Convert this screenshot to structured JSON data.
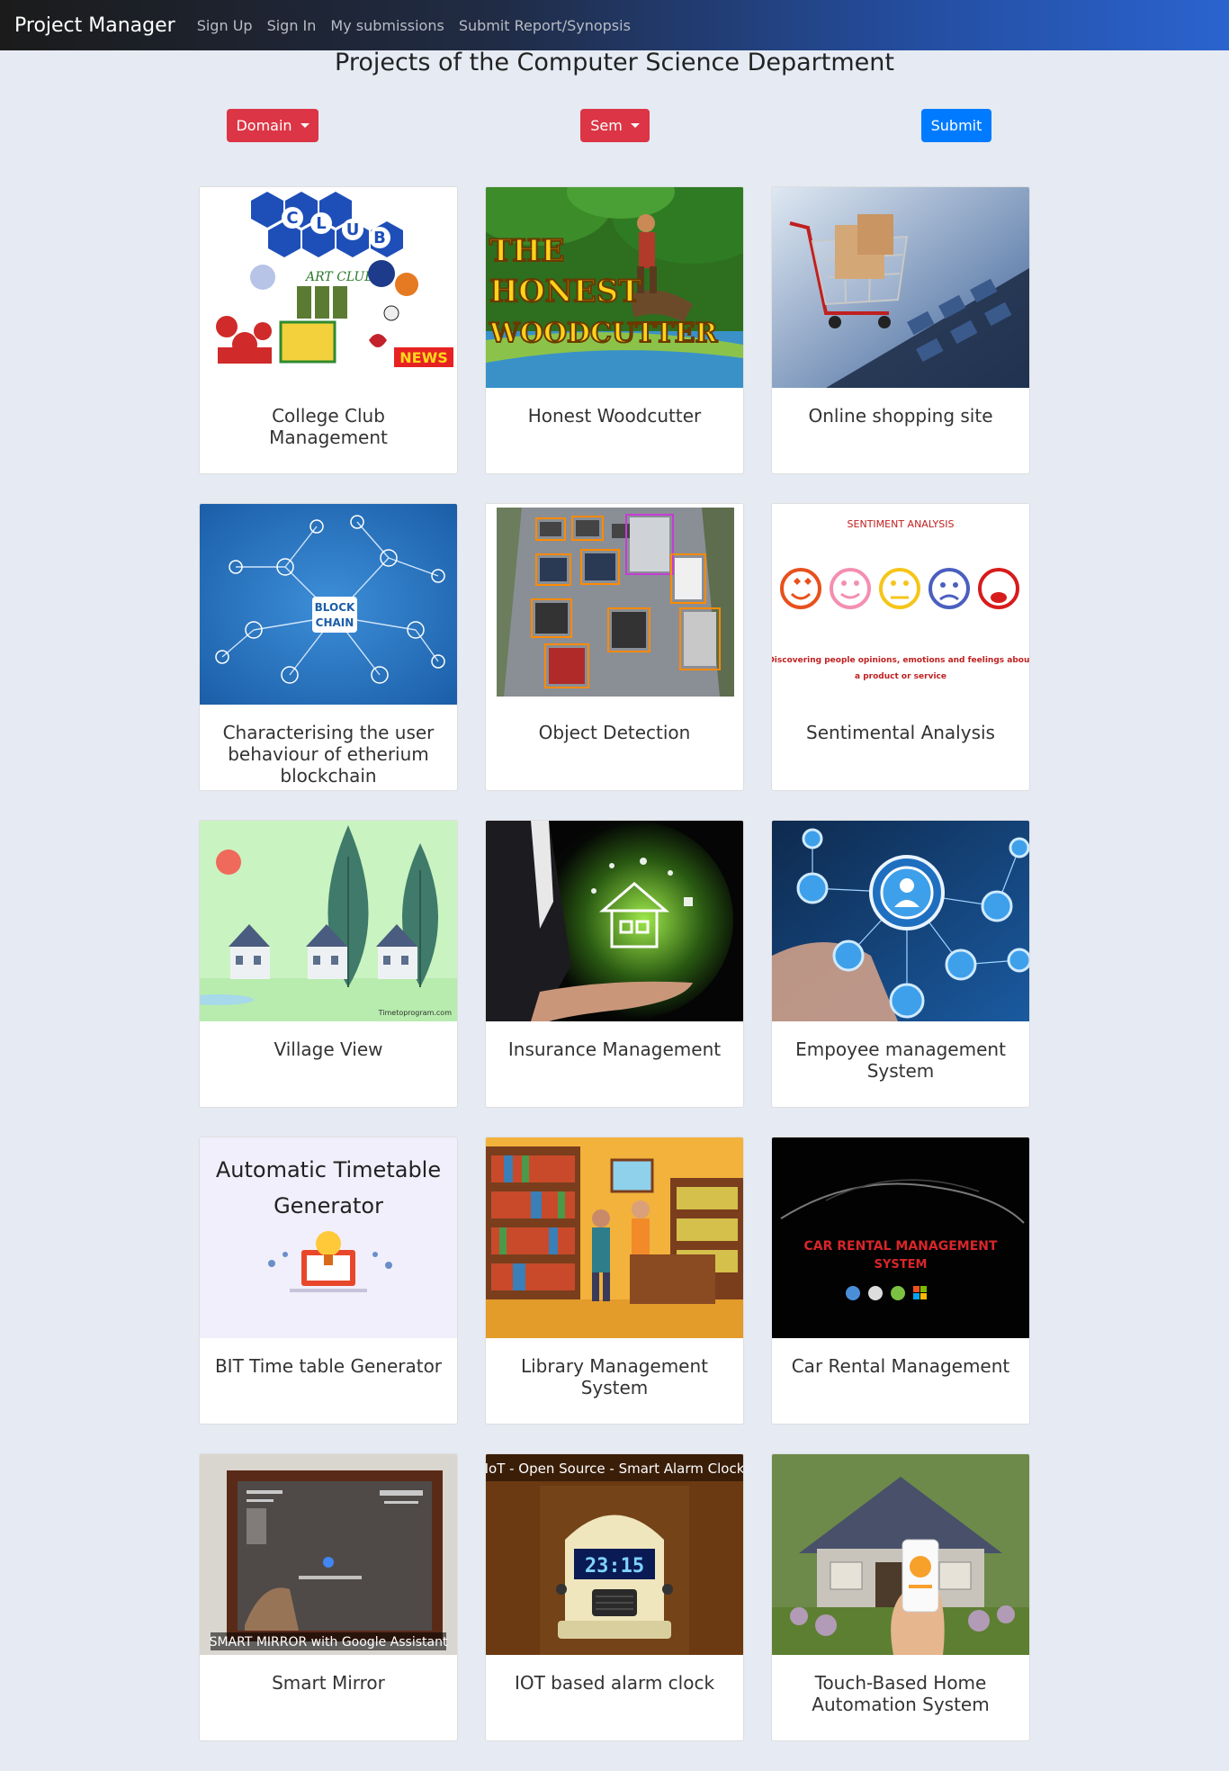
{
  "navbar": {
    "brand": "Project Manager",
    "links": [
      "Sign Up",
      "Sign In",
      "My submissions",
      "Submit Report/Synopsis"
    ]
  },
  "page": {
    "title": "Projects of the Computer Science Department"
  },
  "filters": {
    "domain_label": "Domain",
    "sem_label": "Sem",
    "submit_label": "Submit"
  },
  "colors": {
    "danger": "#dc3545",
    "primary": "#007bff"
  },
  "projects": [
    {
      "title": "College Club Management",
      "image_text": [
        "C",
        "L",
        "U",
        "B",
        "S",
        "ART CLUB",
        "NEWS"
      ]
    },
    {
      "title": "Honest Woodcutter",
      "image_text": [
        "THE",
        "HONEST",
        "WOODCUTTER"
      ]
    },
    {
      "title": "Online shopping site"
    },
    {
      "title": "Characterising the user behaviour of etherium blockchain",
      "image_text": [
        "BLOCK",
        "CHAIN"
      ]
    },
    {
      "title": "Object Detection"
    },
    {
      "title": "Sentimental Analysis",
      "image_text": [
        "SENTIMENT ANALYSIS",
        "Discovering people opinions, emotions and feelings about",
        "a product or service"
      ]
    },
    {
      "title": "Village View",
      "image_text": [
        "Timetoprogram.com"
      ]
    },
    {
      "title": "Insurance Management"
    },
    {
      "title": "Empoyee management System"
    },
    {
      "title": "BIT Time table Generator",
      "image_text": [
        "Automatic Timetable",
        "Generator"
      ]
    },
    {
      "title": "Library Management System"
    },
    {
      "title": "Car Rental Management",
      "image_text": [
        "CAR RENTAL MANAGEMENT",
        "SYSTEM"
      ]
    },
    {
      "title": "Smart Mirror",
      "image_text": [
        "SMART MIRROR with Google Assistant"
      ]
    },
    {
      "title": "IOT based alarm clock",
      "image_text": [
        "IoT - Open Source - Smart Alarm Clock",
        "23:15"
      ]
    },
    {
      "title": "Touch-Based Home Automation System"
    }
  ]
}
